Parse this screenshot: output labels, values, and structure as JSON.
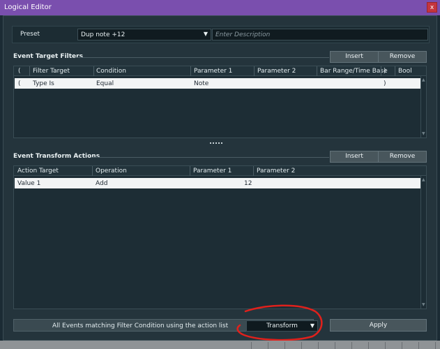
{
  "window": {
    "title": "Logical Editor",
    "close_label": "x"
  },
  "preset": {
    "label": "Preset",
    "value": "Dup note +12",
    "description_placeholder": "Enter Description"
  },
  "filters": {
    "title": "Event Target Filters",
    "insert_label": "Insert",
    "remove_label": "Remove",
    "columns": [
      "(",
      "Filter Target",
      "Condition",
      "Parameter 1",
      "Parameter 2",
      "Bar Range/Time Base",
      ")",
      "Bool"
    ],
    "rows": [
      [
        "(",
        "Type Is",
        "Equal",
        "Note",
        "",
        "",
        ")",
        ""
      ]
    ]
  },
  "actions": {
    "title": "Event Transform Actions",
    "insert_label": "Insert",
    "remove_label": "Remove",
    "columns": [
      "Action Target",
      "Operation",
      "Parameter 1",
      "Parameter 2"
    ],
    "rows": [
      [
        "Value 1",
        "Add",
        "12",
        ""
      ]
    ]
  },
  "bottom": {
    "description": "All Events matching Filter Condition using the action list",
    "mode_value": "Transform",
    "apply_label": "Apply"
  },
  "colors": {
    "titlebar": "#7a4fae",
    "background": "#24343c",
    "close": "#c4353e",
    "annotation": "#e0211c"
  }
}
